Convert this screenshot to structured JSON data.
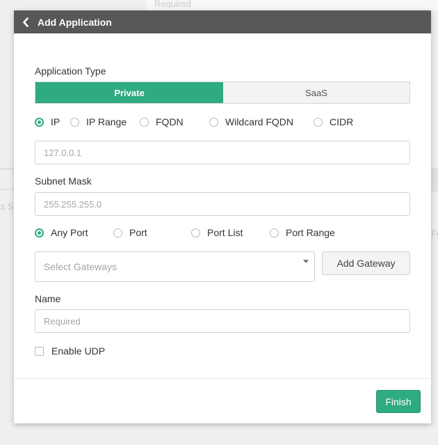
{
  "background": {
    "top_field_placeholder": "Required",
    "left_fragment": "ss S",
    "right_fragment": "Fo"
  },
  "modal": {
    "title": "Add Application",
    "back_icon": "chevron-left-icon"
  },
  "form": {
    "application_type_label": "Application Type",
    "type_options": [
      {
        "label": "Private",
        "selected": true
      },
      {
        "label": "SaaS",
        "selected": false
      }
    ],
    "address_types": [
      {
        "label": "IP",
        "selected": true
      },
      {
        "label": "IP Range",
        "selected": false
      },
      {
        "label": "FQDN",
        "selected": false
      },
      {
        "label": "Wildcard FQDN",
        "selected": false
      },
      {
        "label": "CIDR",
        "selected": false
      }
    ],
    "address_placeholder": "127.0.0.1",
    "subnet_mask_label": "Subnet Mask",
    "subnet_mask_placeholder": "255.255.255.0",
    "port_types": [
      {
        "label": "Any Port",
        "selected": true
      },
      {
        "label": "Port",
        "selected": false
      },
      {
        "label": "Port List",
        "selected": false
      },
      {
        "label": "Port Range",
        "selected": false
      }
    ],
    "gateways_placeholder": "Select Gateways",
    "add_gateway_label": "Add Gateway",
    "name_label": "Name",
    "name_placeholder": "Required",
    "enable_udp_label": "Enable UDP",
    "enable_udp_checked": false
  },
  "footer": {
    "finish_label": "Finish"
  },
  "colors": {
    "accent": "#2fab82",
    "header_bg": "#555758"
  }
}
